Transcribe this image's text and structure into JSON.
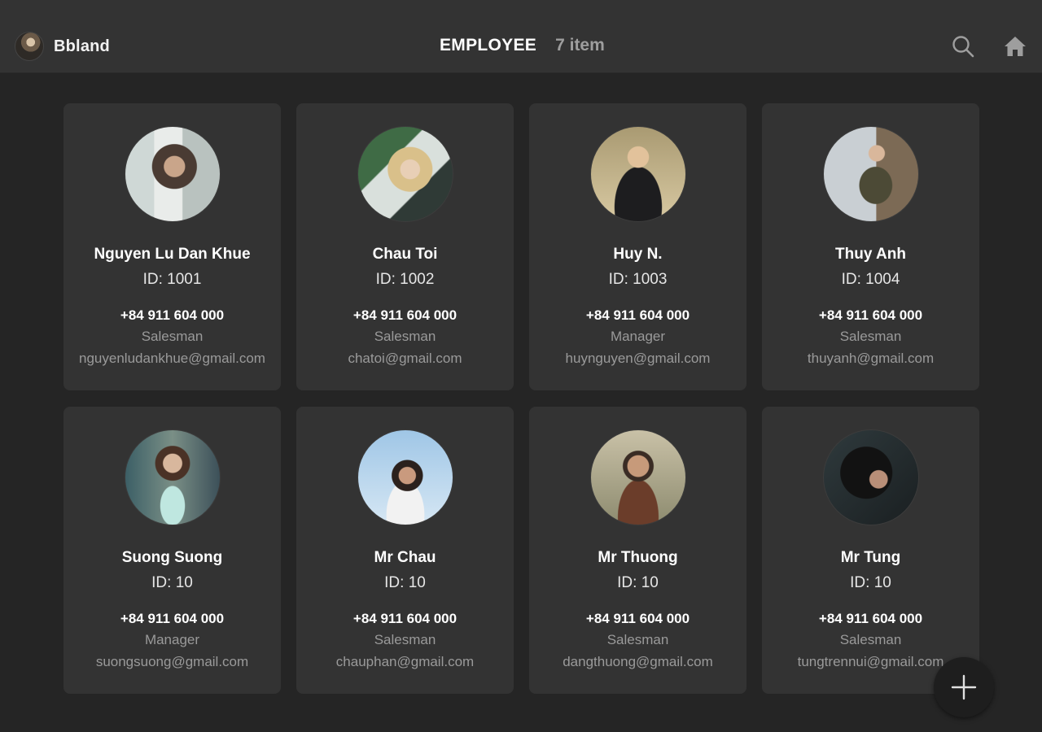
{
  "app": {
    "name": "Bbland"
  },
  "header": {
    "title": "EMPLOYEE",
    "count": "7 item"
  },
  "icons": {
    "search": "search-icon",
    "home": "home-icon",
    "add": "plus-icon"
  },
  "colors": {
    "background": "#252525",
    "card": "#333333",
    "text": "#ffffff",
    "muted": "#9a9a9a"
  },
  "employees": [
    {
      "name": "Nguyen Lu Dan Khue",
      "id": "ID: 1001",
      "phone": "+84 911 604 000",
      "role": "Salesman",
      "email": "nguyenludankhue@gmail.com"
    },
    {
      "name": "Chau Toi",
      "id": "ID: 1002",
      "phone": "+84 911 604 000",
      "role": "Salesman",
      "email": "chatoi@gmail.com"
    },
    {
      "name": "Huy N.",
      "id": "ID: 1003",
      "phone": "+84 911 604 000",
      "role": "Manager",
      "email": "huynguyen@gmail.com"
    },
    {
      "name": "Thuy Anh",
      "id": "ID: 1004",
      "phone": "+84 911 604 000",
      "role": "Salesman",
      "email": "thuyanh@gmail.com"
    },
    {
      "name": "Suong Suong",
      "id": "ID: 10",
      "phone": "+84 911 604 000",
      "role": "Manager",
      "email": "suongsuong@gmail.com"
    },
    {
      "name": "Mr Chau",
      "id": "ID: 10",
      "phone": "+84 911 604 000",
      "role": "Salesman",
      "email": "chauphan@gmail.com"
    },
    {
      "name": "Mr Thuong",
      "id": "ID: 10",
      "phone": "+84 911 604 000",
      "role": "Salesman",
      "email": "dangthuong@gmail.com"
    },
    {
      "name": "Mr Tung",
      "id": "ID: 10",
      "phone": "+84 911 604 000",
      "role": "Salesman",
      "email": "tungtrennui@gmail.com"
    }
  ]
}
